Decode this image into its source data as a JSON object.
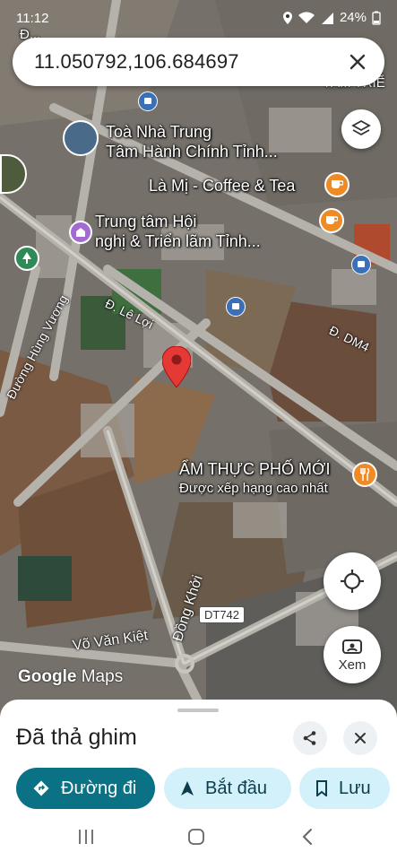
{
  "status": {
    "time": "11:12",
    "battery": "24%"
  },
  "search": {
    "query": "11.050792,106.684697"
  },
  "map": {
    "places": [
      {
        "line1": "Toà Nhà Trung",
        "line2": "Tâm Hành Chính Tỉnh..."
      },
      {
        "line1": "Là Mị - Coffee & Tea"
      },
      {
        "line1": "Trung tâm Hội",
        "line2": "nghị & Triển lãm Tỉnh..."
      }
    ],
    "food": {
      "name": "ẨM THỰC PHỐ MỚI",
      "subtitle": "Được xếp hạng cao nhất"
    },
    "roads": {
      "le_loi": "Đ. Lê Lợi",
      "hung_vuong": "Đường Hùng Vương",
      "dm4": "Đ. DM4",
      "dong_khoi": "Đồng Khởi",
      "vo_van_kiet": "Võ Văn Kiệt",
      "dt742": "DT742"
    },
    "top_fragments": {
      "left": "Đ...",
      "right": "TÂM TRIỂ"
    },
    "logo": {
      "brand": "Google",
      "product": "Maps"
    },
    "streetview_label": "Xem"
  },
  "sheet": {
    "title": "Đã thả ghim",
    "directions_label": "Đường đi",
    "start_label": "Bắt đầu",
    "save_label": "Lưu"
  },
  "colors": {
    "accent": "#0b7285",
    "pin": "#e53935",
    "pill_bg": "#d3f1fb"
  }
}
